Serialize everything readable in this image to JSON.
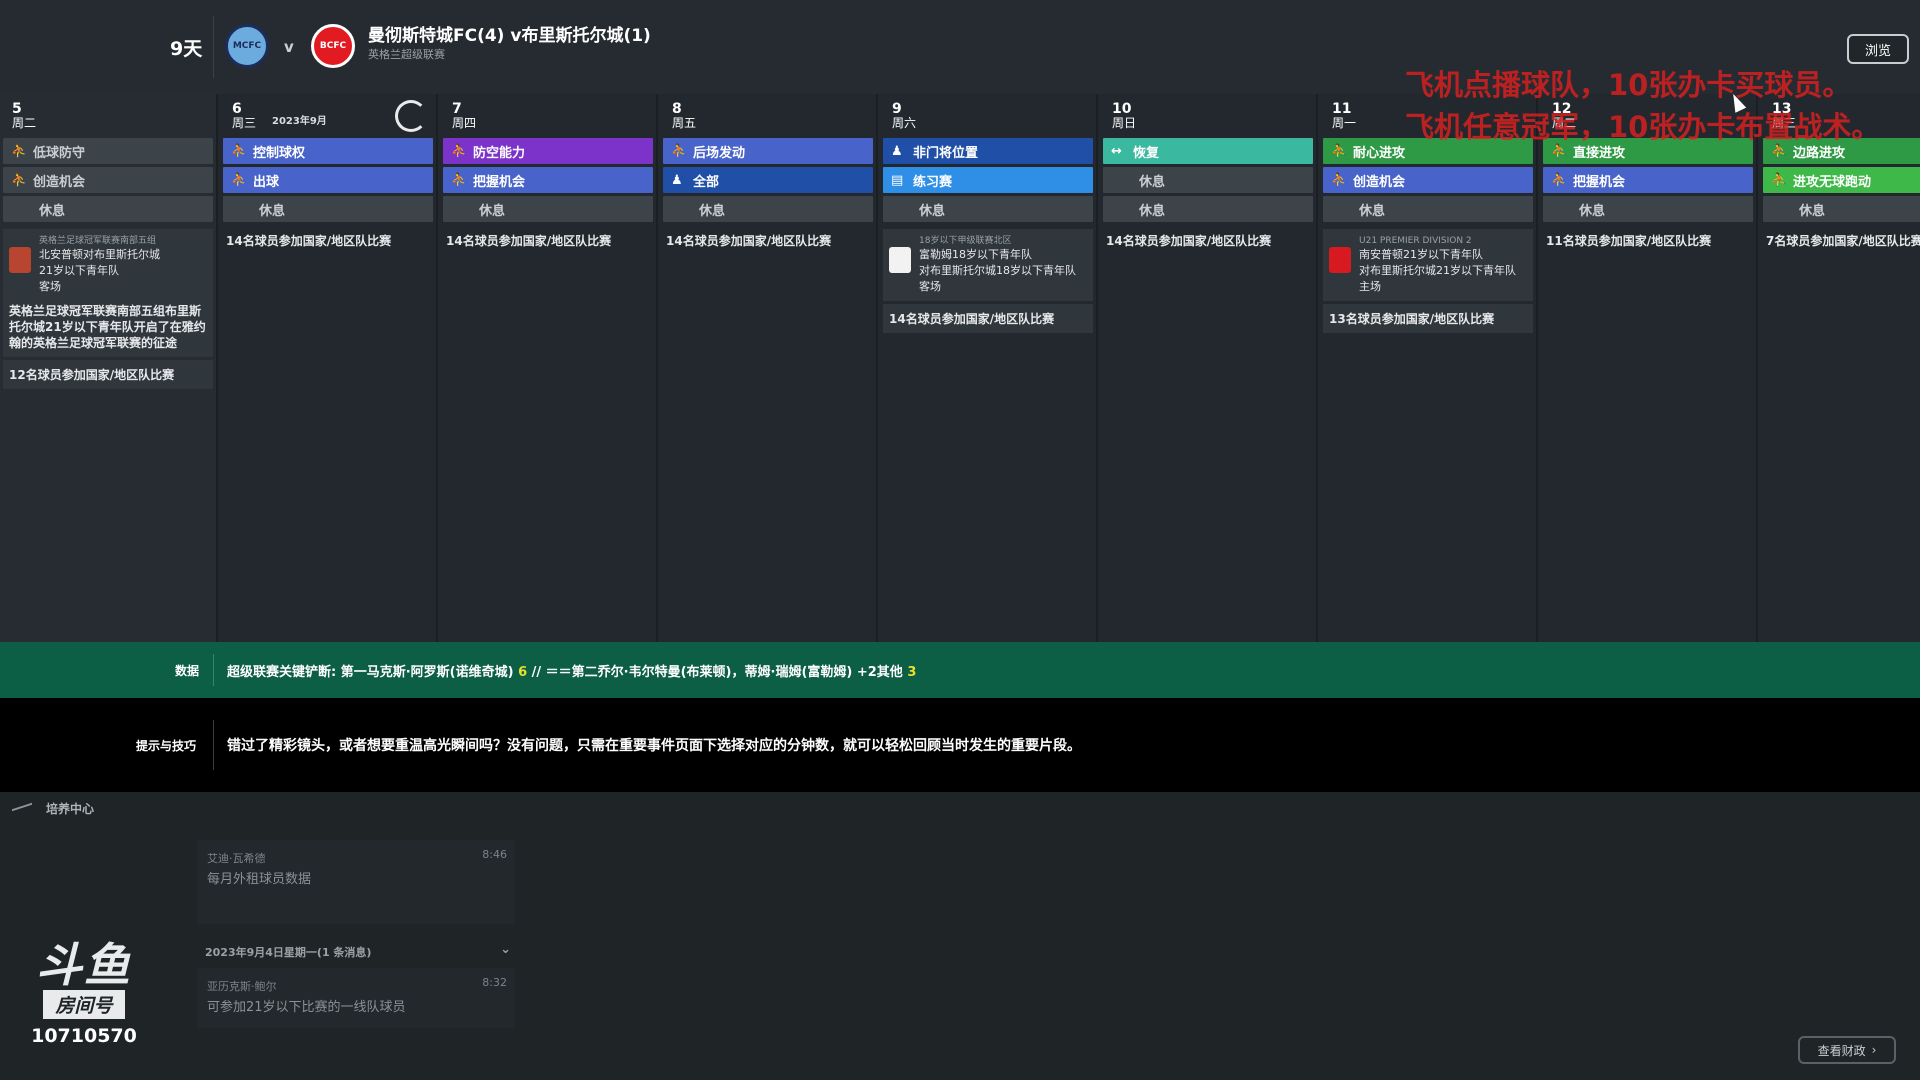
{
  "header": {
    "days_until": "9天",
    "home_crest_text": "MCFC",
    "away_crest_text": "BCFC",
    "vs": "v",
    "match_title": "曼彻斯特城FC(4) v布里斯托尔城(1)",
    "competition": "英格兰超级联赛",
    "browse_label": "浏览"
  },
  "overlay": {
    "line1": "飞机点播球队，10张办卡买球员。",
    "line2": "飞机任意冠军，10张办卡布置战术。"
  },
  "calendar": {
    "month_label": "2023年9月",
    "days": [
      {
        "num": "5",
        "weekday": "周二",
        "sessions": [
          {
            "icon": "⛹",
            "label": "低球防守",
            "style": "gray"
          },
          {
            "icon": "⛹",
            "label": "创造机会",
            "style": "gray"
          },
          {
            "icon": "",
            "label": "休息",
            "style": "rest"
          }
        ]
      },
      {
        "num": "6",
        "weekday": "周三",
        "sessions": [
          {
            "icon": "⛹",
            "label": "控制球权",
            "style": "blue"
          },
          {
            "icon": "⛹",
            "label": "出球",
            "style": "blue"
          },
          {
            "icon": "",
            "label": "休息",
            "style": "rest"
          }
        ],
        "intl": "14名球员参加国家/地区队比赛"
      },
      {
        "num": "7",
        "weekday": "周四",
        "sessions": [
          {
            "icon": "⛹",
            "label": "防空能力",
            "style": "purple"
          },
          {
            "icon": "⛹",
            "label": "把握机会",
            "style": "blue"
          },
          {
            "icon": "",
            "label": "休息",
            "style": "rest"
          }
        ],
        "intl": "14名球员参加国家/地区队比赛"
      },
      {
        "num": "8",
        "weekday": "周五",
        "sessions": [
          {
            "icon": "⛹",
            "label": "后场发动",
            "style": "blue"
          },
          {
            "icon": "♟",
            "label": "全部",
            "style": "darkblue"
          },
          {
            "icon": "",
            "label": "休息",
            "style": "rest"
          }
        ],
        "intl": "14名球员参加国家/地区队比赛"
      },
      {
        "num": "9",
        "weekday": "周六",
        "sessions": [
          {
            "icon": "♟",
            "label": "非门将位置",
            "style": "darkblue"
          },
          {
            "icon": "▤",
            "label": "练习赛",
            "style": "lightblue"
          },
          {
            "icon": "",
            "label": "休息",
            "style": "rest"
          }
        ]
      },
      {
        "num": "10",
        "weekday": "周日",
        "sessions": [
          {
            "icon": "↔",
            "label": "恢复",
            "style": "teal"
          },
          {
            "icon": "",
            "label": "休息",
            "style": "rest"
          },
          {
            "icon": "",
            "label": "休息",
            "style": "rest"
          }
        ],
        "intl": "14名球员参加国家/地区队比赛"
      },
      {
        "num": "11",
        "weekday": "周一",
        "sessions": [
          {
            "icon": "⛹",
            "label": "耐心进攻",
            "style": "green"
          },
          {
            "icon": "⛹",
            "label": "创造机会",
            "style": "blue"
          },
          {
            "icon": "",
            "label": "休息",
            "style": "rest"
          }
        ]
      },
      {
        "num": "12",
        "weekday": "周二",
        "sessions": [
          {
            "icon": "⛹",
            "label": "直接进攻",
            "style": "green"
          },
          {
            "icon": "⛹",
            "label": "把握机会",
            "style": "blue"
          },
          {
            "icon": "",
            "label": "休息",
            "style": "rest"
          }
        ],
        "intl": "11名球员参加国家/地区队比赛"
      },
      {
        "num": "13",
        "weekday": "周三",
        "sessions": [
          {
            "icon": "⛹",
            "label": "边路进攻",
            "style": "green"
          },
          {
            "icon": "⛹",
            "label": "进攻无球跑动",
            "style": "lime"
          },
          {
            "icon": "",
            "label": "休息",
            "style": "rest"
          }
        ],
        "intl": "7名球员参加国家/地区队比赛"
      }
    ],
    "event_day5": {
      "league": "英格兰足球冠军联赛南部五组",
      "line1": "北安普顿对布里斯托尔城",
      "line2": "21岁以下青年队",
      "line3": "客场",
      "note": "英格兰足球冠军联赛南部五组布里斯托尔城21岁以下青年队开启了在雅约翰的英格兰足球冠军联赛的征途",
      "intl": "12名球员参加国家/地区队比赛"
    },
    "event_day9": {
      "league": "18岁以下甲级联赛北区",
      "line1": "富勒姆18岁以下青年队",
      "line2": "对布里斯托尔城18岁以下青年队",
      "line3": "客场",
      "intl": "14名球员参加国家/地区队比赛"
    },
    "event_day11": {
      "league": "U21 PREMIER DIVISION 2",
      "line1": "南安普顿21岁以下青年队",
      "line2": "对布里斯托尔城21岁以下青年队",
      "line3": "主场",
      "intl": "13名球员参加国家/地区队比赛"
    }
  },
  "stats": {
    "label": "数据",
    "text_before": "超级联赛关键铲断: 第一马克斯·阿罗斯(诺维奇城)",
    "value1": "6",
    "text_middle": "// ＝＝第二乔尔·韦尔特曼(布莱顿)，蒂姆·瑞姆(富勒姆) +2其他",
    "value2": "3"
  },
  "tips": {
    "label": "提示与技巧",
    "text": "错过了精彩镜头，或者想要重温高光瞬间吗？没有问题，只需在重要事件页面下选择对应的分钟数，就可以轻松回顾当时发生的重要片段。"
  },
  "inbox": {
    "title": "培养中心",
    "msg1": {
      "from": "艾迪·瓦希德",
      "time": "8:46",
      "subject": "每月外租球员数据"
    },
    "date_group": "2023年9月4日星期一(1 条消息)",
    "msg2": {
      "from": "亚历克斯·鲍尔",
      "time": "8:32",
      "subject": "可参加21岁以下比赛的一线队球员"
    },
    "finance_label": "查看财政"
  },
  "watermark": {
    "logo": "斗鱼",
    "room_label": "房间号",
    "room_number": "10710570"
  }
}
